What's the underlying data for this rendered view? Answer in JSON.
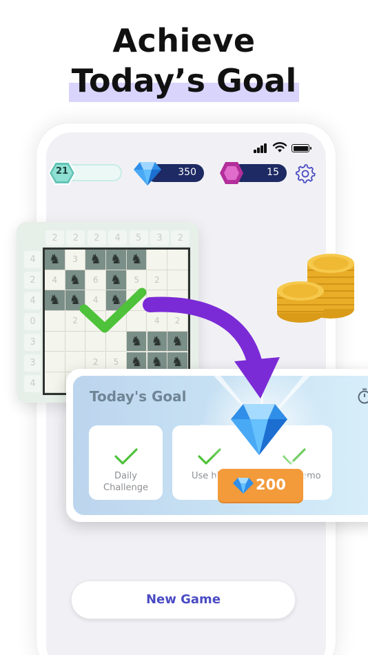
{
  "headline": {
    "line1": "Achieve",
    "line2": "Today’s Goal"
  },
  "status_bar": {
    "icons": [
      "signal-icon",
      "wifi-icon",
      "battery-icon"
    ]
  },
  "stats": {
    "level": "21",
    "gems": "350",
    "rubies": "15",
    "settings_icon": "gear-icon"
  },
  "board": {
    "top_clues": [
      "2",
      "2",
      "2",
      "4",
      "5",
      "3",
      "2"
    ],
    "left_clues": [
      "4",
      "2",
      "4",
      "0",
      "3",
      "3",
      "4"
    ],
    "cells": [
      [
        "♞",
        "3",
        "♞",
        "♞",
        "♞",
        "",
        ""
      ],
      [
        "4",
        "♞",
        "6",
        "♞",
        "5",
        "2",
        ""
      ],
      [
        "♞",
        "♞",
        "4",
        "♞",
        "",
        "",
        ""
      ],
      [
        "",
        "2",
        "",
        "",
        "",
        "4",
        "2"
      ],
      [
        "",
        "",
        "",
        "",
        "♞",
        "♞",
        "♞"
      ],
      [
        "",
        "",
        "2",
        "5",
        "♞",
        "♞",
        "♞"
      ],
      [
        "",
        "",
        "",
        "",
        "",
        "",
        ""
      ]
    ]
  },
  "goal": {
    "title": "Today's Goal",
    "tasks": [
      {
        "label": "Daily\nChallenge"
      },
      {
        "label": "Use hi"
      },
      {
        "label": "emo"
      }
    ],
    "reward": "200"
  },
  "new_game_label": "New Game",
  "colors": {
    "accent": "#4a4bc3",
    "reward": "#f39a3b",
    "highlight": "#d9d4fb",
    "navy": "#1d2a63",
    "check": "#4ec23a",
    "arrow": "#7b2bd6"
  }
}
